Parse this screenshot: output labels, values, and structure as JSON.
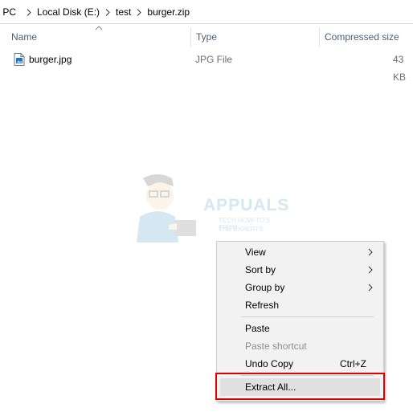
{
  "breadcrumb": {
    "items": [
      "s PC",
      "Local Disk (E:)",
      "test",
      "burger.zip"
    ]
  },
  "columns": {
    "name": "Name",
    "type": "Type",
    "compressed_size": "Compressed size"
  },
  "files": [
    {
      "name": "burger.jpg",
      "type": "JPG File",
      "size": "43 KB",
      "icon": "image-file-icon"
    }
  ],
  "watermark": {
    "title": "APPUALS",
    "line1": "TECH HOW-TO'S FROM",
    "line2": "THE EXPERTS"
  },
  "context_menu": {
    "items": [
      {
        "label": "View",
        "submenu": true,
        "disabled": false
      },
      {
        "label": "Sort by",
        "submenu": true,
        "disabled": false
      },
      {
        "label": "Group by",
        "submenu": true,
        "disabled": false
      },
      {
        "label": "Refresh",
        "submenu": false,
        "disabled": false
      },
      {
        "label": "Paste",
        "submenu": false,
        "disabled": false
      },
      {
        "label": "Paste shortcut",
        "submenu": false,
        "disabled": true
      },
      {
        "label": "Undo Copy",
        "shortcut": "Ctrl+Z",
        "submenu": false,
        "disabled": false
      },
      {
        "label": "Extract All...",
        "submenu": false,
        "disabled": false,
        "highlighted": true
      }
    ]
  },
  "colors": {
    "header_text": "#4c607a",
    "highlight_border": "#e00000",
    "menu_background": "#f2f2f2"
  }
}
